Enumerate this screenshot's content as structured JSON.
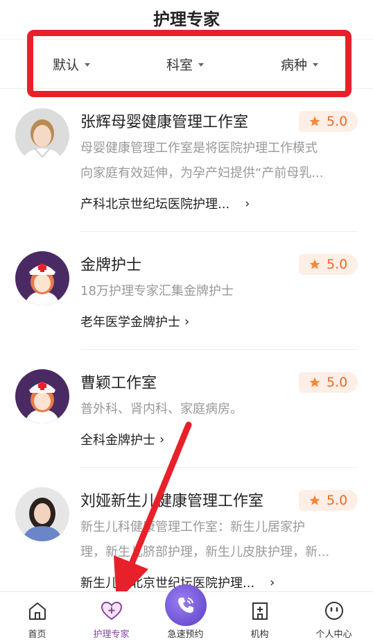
{
  "header": {
    "title": "护理专家"
  },
  "filters": [
    {
      "label": "默认"
    },
    {
      "label": "科室"
    },
    {
      "label": "病种"
    }
  ],
  "items": [
    {
      "title": "张辉母婴健康管理工作室",
      "rating": "5.0",
      "desc": [
        "母婴健康管理工作室是将医院护理工作模式",
        "向家庭有效延伸，为孕产妇提供“产前母乳..."
      ],
      "tag": "产科北京世纪坛医院护理...",
      "chevron": "›"
    },
    {
      "title": "金牌护士",
      "rating": "5.0",
      "desc": [
        "18万护理专家汇集金牌护士"
      ],
      "tag": "老年医学金牌护士",
      "chevron": "›"
    },
    {
      "title": "曹颖工作室",
      "rating": "5.0",
      "desc": [
        "普外科、肾内科、家庭病房。"
      ],
      "tag": "全科金牌护士",
      "chevron": "›"
    },
    {
      "title": "刘娅新生儿健康管理工作室",
      "rating": "5.0",
      "desc": [
        "新生儿科健康管理工作室：新生儿居家护",
        "理，新生儿脐部护理，新生儿皮肤护理，新..."
      ],
      "tag": "新生儿科北京世纪坛医院护理...",
      "chevron": "›"
    }
  ],
  "tabs": [
    {
      "label": "首页",
      "icon": "home-icon"
    },
    {
      "label": "护理专家",
      "icon": "heart-plus-icon",
      "active": true
    },
    {
      "label": "急速预约",
      "icon": "phone-icon"
    },
    {
      "label": "机构",
      "icon": "building-icon"
    },
    {
      "label": "个人中心",
      "icon": "face-icon"
    }
  ],
  "colors": {
    "accent": "#8a3fa6",
    "rating": "#e76b23",
    "highlight": "#e8202a"
  }
}
